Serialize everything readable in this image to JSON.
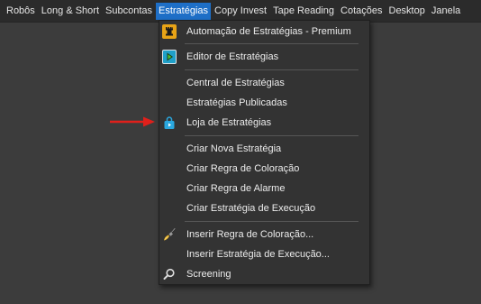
{
  "menubar": {
    "items": [
      "Robôs",
      "Long & Short",
      "Subcontas",
      "Estratégias",
      "Copy Invest",
      "Tape Reading",
      "Cotações",
      "Desktop",
      "Janela"
    ],
    "active_index": 3
  },
  "dropdown": {
    "items": [
      {
        "label": "Automação de Estratégias - Premium",
        "icon": "chess-rook-icon"
      },
      {
        "label": "Editor de Estratégias",
        "icon": "play-editor-icon"
      },
      {
        "label": "Central de Estratégias",
        "icon": ""
      },
      {
        "label": "Estratégias Publicadas",
        "icon": ""
      },
      {
        "label": "Loja de Estratégias",
        "icon": "shopping-bag-icon"
      },
      {
        "label": "Criar Nova Estratégia",
        "icon": ""
      },
      {
        "label": "Criar Regra de Coloração",
        "icon": ""
      },
      {
        "label": "Criar Regra de Alarme",
        "icon": ""
      },
      {
        "label": "Criar Estratégia de Execução",
        "icon": ""
      },
      {
        "label": "Inserir Regra de Coloração...",
        "icon": "paintbrush-icon"
      },
      {
        "label": "Inserir Estratégia de Execução...",
        "icon": ""
      },
      {
        "label": "Screening",
        "icon": "search-icon"
      }
    ]
  },
  "colors": {
    "active_menu": "#1e6fc7",
    "annotation_arrow": "#e0201b",
    "rook_icon": "#e8a417",
    "store_icon": "#2aa7de"
  }
}
